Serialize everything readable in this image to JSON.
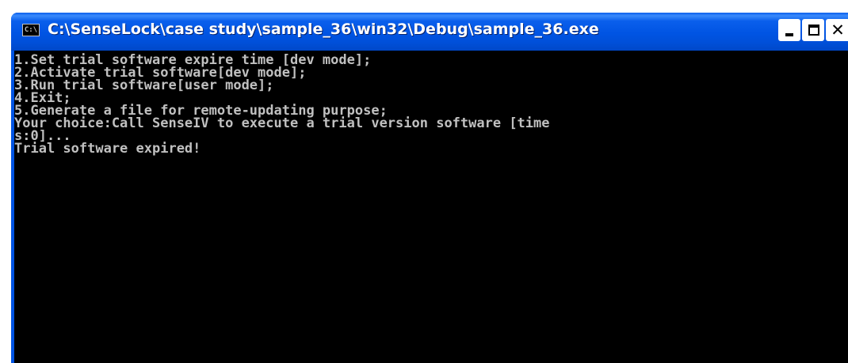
{
  "window": {
    "title": "C:\\SenseLock\\case study\\sample_36\\win32\\Debug\\sample_36.exe",
    "app_icon": "C:\\",
    "buttons": {
      "minimize_icon": "minimize-icon",
      "maximize_icon": "maximize-icon",
      "close_icon": "close-icon",
      "close_glyph": "✕"
    }
  },
  "console": {
    "lines": [
      "1.Set trial software expire time [dev mode];",
      "2.Activate trial software[dev mode];",
      "3.Run trial software[user mode];",
      "4.Exit;",
      "5.Generate a file for remote-updating purpose;",
      "Your choice:Call SenseIV to execute a trial version software [time",
      "s:0]...",
      "Trial software expired!"
    ]
  },
  "colors": {
    "titlebar": "#0054e3",
    "console_bg": "#000000",
    "console_text": "#c0c0c0"
  }
}
